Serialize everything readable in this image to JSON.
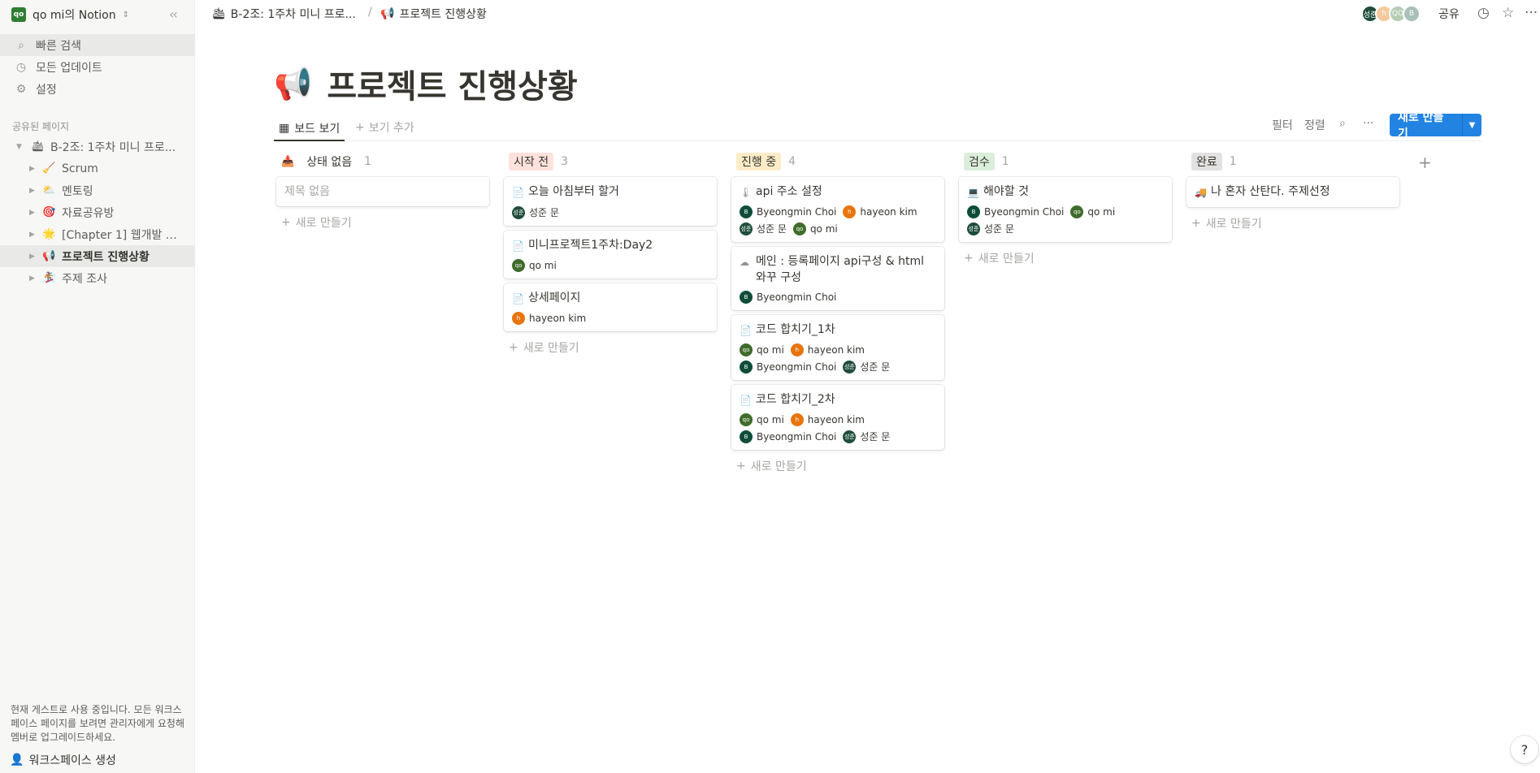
{
  "workspace": {
    "badge": "qo",
    "name": "qo mi의 Notion"
  },
  "sidebar": {
    "menu": [
      {
        "icon": "⌕",
        "label": "빠른 검색"
      },
      {
        "icon": "◷",
        "label": "모든 업데이트"
      },
      {
        "icon": "⚙",
        "label": "설정"
      }
    ],
    "section_label": "공유된 페이지",
    "tree": [
      {
        "toggle": "▼",
        "icon": "🛳",
        "label": "B-2조: 1주차 미니 프로..."
      },
      {
        "toggle": "▶",
        "icon": "🧹",
        "label": "Scrum"
      },
      {
        "toggle": "▶",
        "icon": "⛅",
        "label": "멘토링"
      },
      {
        "toggle": "▶",
        "icon": "🎯",
        "label": "자료공유방"
      },
      {
        "toggle": "▶",
        "icon": "🌟",
        "label": "[Chapter 1] 웹개발 미..."
      },
      {
        "toggle": "▶",
        "icon": "📢",
        "label": "프로젝트 진행상황"
      },
      {
        "toggle": "▶",
        "icon": "🏂",
        "label": "주제 조사"
      }
    ],
    "guest_note": "현재 게스트로 사용 중입니다. 모든 워크스페이스 페이지를 보려면 관리자에게 요청해 멤버로 업그레이드하세요.",
    "create_workspace": "워크스페이스 생성"
  },
  "topbar": {
    "crumb1": {
      "icon": "🛳",
      "label": "B-2조: 1주차 미니 프로..."
    },
    "sep": "/",
    "crumb2": {
      "icon": "📢",
      "label": "프로젝트 진행상황"
    },
    "avatars": [
      {
        "text": "성준",
        "color": "#1f4d3a"
      },
      {
        "text": "h",
        "color": "#f6c99c"
      },
      {
        "text": "QO",
        "color": "#b6cdb3"
      },
      {
        "text": "B",
        "color": "#a9c0b6"
      }
    ],
    "share": "공유"
  },
  "page": {
    "icon": "📢",
    "title": "프로젝트 진행상황"
  },
  "views": {
    "tab_label": "보드 보기",
    "add_label": "보기 추가",
    "filter": "필터",
    "sort": "정렬",
    "new_button": "새로 만들기"
  },
  "columns": [
    {
      "label": "상태 없음",
      "count": "1",
      "tag_bg": "transparent",
      "icon": "📥",
      "new_label": "새로 만들기",
      "cards": [
        {
          "title": "제목 없음",
          "placeholder": true,
          "icon": "",
          "people": []
        }
      ]
    },
    {
      "label": "시작 전",
      "count": "3",
      "tag_bg": "#ffe2dd",
      "icon": "",
      "new_label": "새로 만들기",
      "cards": [
        {
          "title": "오늘 아침부터 할거",
          "icon": "📄",
          "people": [
            {
              "name": "성준 문",
              "init": "성준",
              "color": "#1f4d3a"
            }
          ]
        },
        {
          "title": "미니프로젝트1주차:Day2",
          "icon": "📄",
          "people": [
            {
              "name": "qo mi",
              "init": "qo",
              "color": "#3f6b2b"
            }
          ]
        },
        {
          "title": "상세페이지",
          "icon": "📄",
          "people": [
            {
              "name": "hayeon kim",
              "init": "h",
              "color": "#e8740c"
            }
          ]
        }
      ]
    },
    {
      "label": "진행 중",
      "count": "4",
      "tag_bg": "#fdecc8",
      "icon": "",
      "new_label": "새로 만들기",
      "cards": [
        {
          "title": "api 주소 설정",
          "icon": "🌡",
          "people": [
            {
              "name": "Byeongmin Choi",
              "init": "B",
              "color": "#0f4c3a"
            },
            {
              "name": "hayeon kim",
              "init": "h",
              "color": "#e8740c"
            },
            {
              "name": "성준 문",
              "init": "성준",
              "color": "#1f4d3a"
            },
            {
              "name": "qo mi",
              "init": "qo",
              "color": "#3f6b2b"
            }
          ]
        },
        {
          "title": "메인 : 등록페이지 api구성 & html 와꾸 구성",
          "icon": "☁",
          "people": [
            {
              "name": "Byeongmin Choi",
              "init": "B",
              "color": "#0f4c3a"
            }
          ]
        },
        {
          "title": "코드 합치기_1차",
          "icon": "📄",
          "people": [
            {
              "name": "qo mi",
              "init": "qo",
              "color": "#3f6b2b"
            },
            {
              "name": "hayeon kim",
              "init": "h",
              "color": "#e8740c"
            },
            {
              "name": "Byeongmin Choi",
              "init": "B",
              "color": "#0f4c3a"
            },
            {
              "name": "성준 문",
              "init": "성준",
              "color": "#1f4d3a"
            }
          ]
        },
        {
          "title": "코드 합치기_2차",
          "icon": "📄",
          "people": [
            {
              "name": "qo mi",
              "init": "qo",
              "color": "#3f6b2b"
            },
            {
              "name": "hayeon kim",
              "init": "h",
              "color": "#e8740c"
            },
            {
              "name": "Byeongmin Choi",
              "init": "B",
              "color": "#0f4c3a"
            },
            {
              "name": "성준 문",
              "init": "성준",
              "color": "#1f4d3a"
            }
          ]
        }
      ]
    },
    {
      "label": "검수",
      "count": "1",
      "tag_bg": "#dbeddb",
      "icon": "",
      "new_label": "새로 만들기",
      "cards": [
        {
          "title": "해야할 것",
          "icon": "💻",
          "people": [
            {
              "name": "Byeongmin Choi",
              "init": "B",
              "color": "#0f4c3a"
            },
            {
              "name": "qo mi",
              "init": "qo",
              "color": "#3f6b2b"
            },
            {
              "name": "성준 문",
              "init": "성준",
              "color": "#1f4d3a"
            }
          ]
        }
      ]
    },
    {
      "label": "완료",
      "count": "1",
      "tag_bg": "#e3e2e0",
      "icon": "",
      "new_label": "새로 만들기",
      "cards": [
        {
          "title": "나 혼자 산탄다. 주제선정",
          "icon": "🚚",
          "people": []
        }
      ]
    }
  ],
  "help": "?"
}
